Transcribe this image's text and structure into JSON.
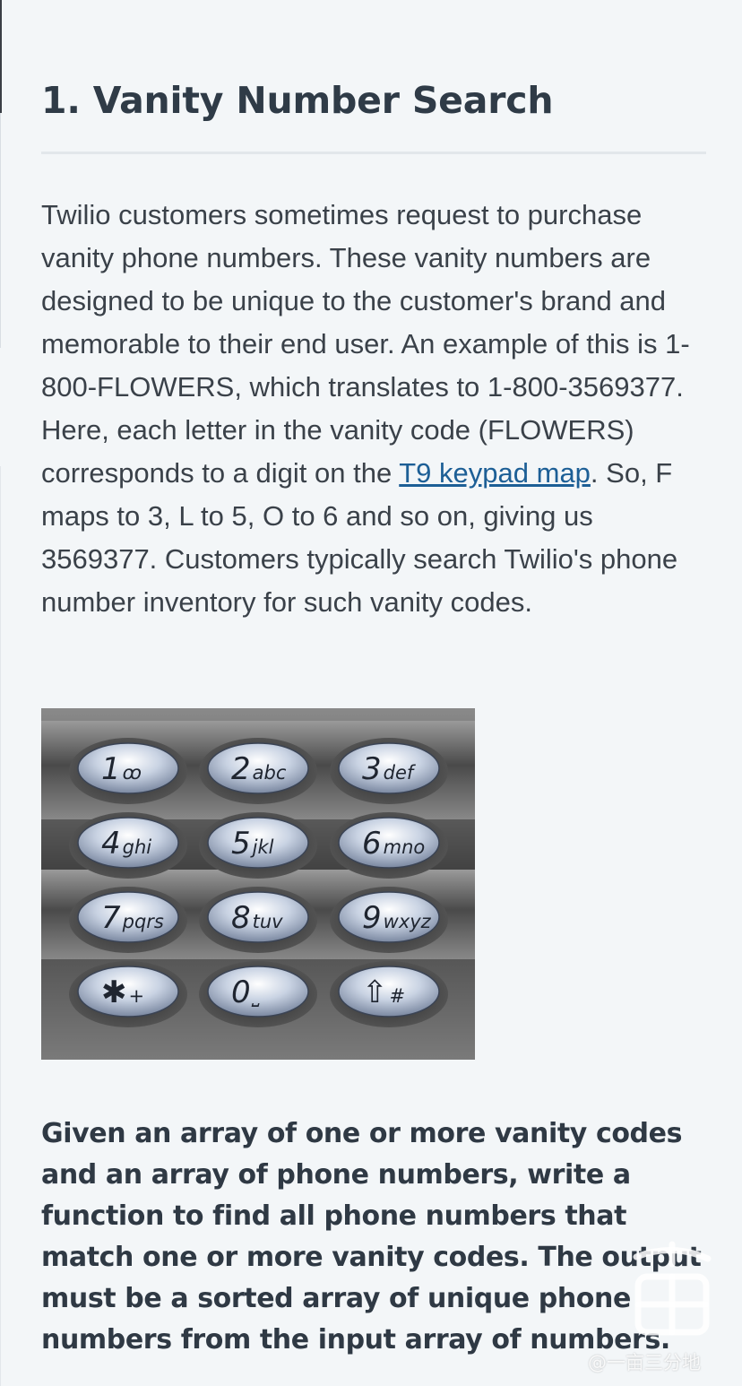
{
  "heading": "1. Vanity Number Search",
  "paragraph": {
    "before_link": "Twilio customers sometimes request to purchase vanity phone numbers. These vanity numbers are designed to be unique to the customer's brand and memorable to their end user. An example of this is 1-800-FLOWERS, which translates to 1-800-3569377. Here, each letter in the vanity code (FLOWERS) corresponds to a digit on the ",
    "link_text": "T9 keypad map",
    "after_link": ". So, F maps to 3, L to 5, O to 6 and so on, giving us 3569377. Customers typically search Twilio's phone number inventory for such vanity codes."
  },
  "keypad": {
    "keys": [
      {
        "digit": "1",
        "letters": "ꝏ"
      },
      {
        "digit": "2",
        "letters": "abc"
      },
      {
        "digit": "3",
        "letters": "def"
      },
      {
        "digit": "4",
        "letters": "ghi"
      },
      {
        "digit": "5",
        "letters": "jkl"
      },
      {
        "digit": "6",
        "letters": "mno"
      },
      {
        "digit": "7",
        "letters": "pqrs"
      },
      {
        "digit": "8",
        "letters": "tuv"
      },
      {
        "digit": "9",
        "letters": "wxyz"
      },
      {
        "digit": "✱",
        "letters": "+"
      },
      {
        "digit": "0",
        "letters": "⎵"
      },
      {
        "digit": "⇧",
        "letters": "#"
      }
    ]
  },
  "task": "Given an array of one or more vanity codes and an array of phone numbers, write a function to find all phone numbers that match one or more vanity codes. The output must be a sorted array of unique phone numbers from the input array of numbers.",
  "watermark": "@一亩三分地"
}
